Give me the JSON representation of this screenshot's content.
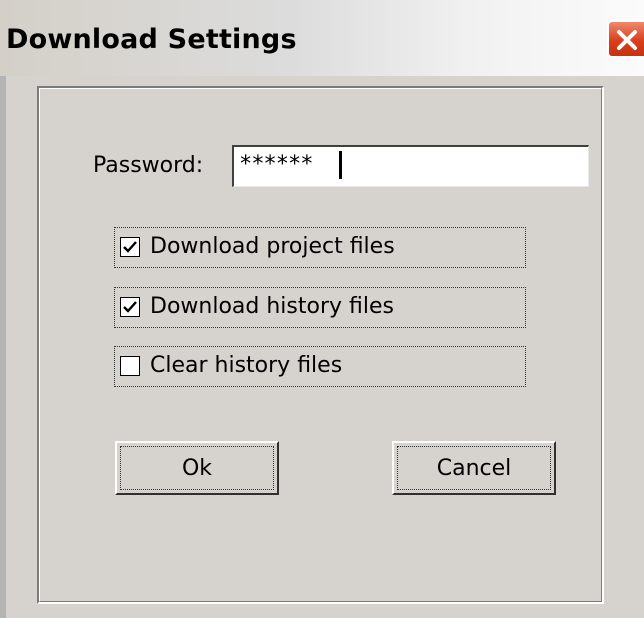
{
  "window": {
    "title": "Download Settings"
  },
  "password": {
    "label": "Password:",
    "value": "******"
  },
  "options": [
    {
      "label": "Download project files",
      "checked": true
    },
    {
      "label": "Download history files",
      "checked": true
    },
    {
      "label": "Clear history files",
      "checked": false
    }
  ],
  "buttons": {
    "ok_label": "Ok",
    "cancel_label": "Cancel"
  },
  "colors": {
    "dialog_background": "#d6d3ce",
    "close_button": "#d9401c"
  }
}
